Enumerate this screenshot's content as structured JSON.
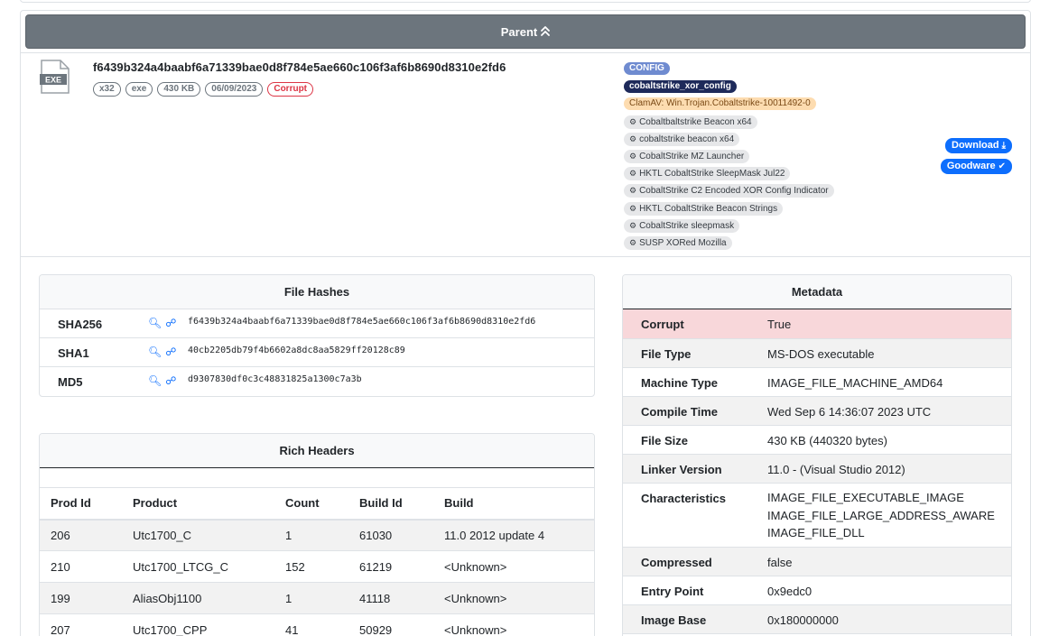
{
  "parent": {
    "label": "Parent"
  },
  "file": {
    "sha256": "f6439b324a4baabf6a71339bae0d8f784e5ae660c106f3af6b8690d8310e2fd6",
    "icon_label": "EXE",
    "pills": [
      "x32",
      "exe",
      "430 KB",
      "06/09/2023",
      "Corrupt"
    ]
  },
  "tags": {
    "config": "CONFIG",
    "family": "cobaltstrike_xor_config",
    "clamav": "ClamAV: Win.Trojan.Cobaltstrike-10011492-0",
    "yara": [
      "Cobaltbaltstrike Beacon x64",
      "cobaltstrike beacon x64",
      "CobaltStrike MZ Launcher",
      "HKTL CobaltStrike SleepMask Jul22",
      "CobaltStrike C2 Encoded XOR Config Indicator",
      "HKTL CobaltStrike Beacon Strings",
      "CobaltStrike sleepmask",
      "SUSP XORed Mozilla"
    ]
  },
  "actions": {
    "download": "Download",
    "goodware": "Goodware"
  },
  "hashes": {
    "title": "File Hashes",
    "rows": [
      {
        "label": "SHA256",
        "value": "f6439b324a4baabf6a71339bae0d8f784e5ae660c106f3af6b8690d8310e2fd6"
      },
      {
        "label": "SHA1",
        "value": "40cb2205db79f4b6602a8dc8aa5829ff20128c89"
      },
      {
        "label": "MD5",
        "value": "d9307830df0c3c48831825a1300c7a3b"
      }
    ]
  },
  "rich": {
    "title": "Rich Headers",
    "columns": [
      "Prod Id",
      "Product",
      "Count",
      "Build Id",
      "Build"
    ],
    "rows": [
      [
        "206",
        "Utc1700_C",
        "1",
        "61030",
        "11.0 2012 update 4"
      ],
      [
        "210",
        "Utc1700_LTCG_C",
        "152",
        "61219",
        "<Unknown>"
      ],
      [
        "199",
        "AliasObj1100",
        "1",
        "41118",
        "<Unknown>"
      ],
      [
        "207",
        "Utc1700_CPP",
        "41",
        "50929",
        "<Unknown>"
      ]
    ]
  },
  "metadata": {
    "title": "Metadata",
    "rows": [
      {
        "key": "Corrupt",
        "value": "True"
      },
      {
        "key": "File Type",
        "value": "MS-DOS executable"
      },
      {
        "key": "Machine Type",
        "value": "IMAGE_FILE_MACHINE_AMD64"
      },
      {
        "key": "Compile Time",
        "value": "Wed Sep 6 14:36:07 2023 UTC"
      },
      {
        "key": "File Size",
        "value": "430 KB (440320 bytes)"
      },
      {
        "key": "Linker Version",
        "value": "11.0 - (Visual Studio 2012)"
      },
      {
        "key": "Characteristics",
        "value": "IMAGE_FILE_EXECUTABLE_IMAGE\nIMAGE_FILE_LARGE_ADDRESS_AWARE\nIMAGE_FILE_DLL"
      },
      {
        "key": "Compressed",
        "value": "false"
      },
      {
        "key": "Entry Point",
        "value": "0x9edc0"
      },
      {
        "key": "Image Base",
        "value": "0x180000000"
      }
    ]
  }
}
